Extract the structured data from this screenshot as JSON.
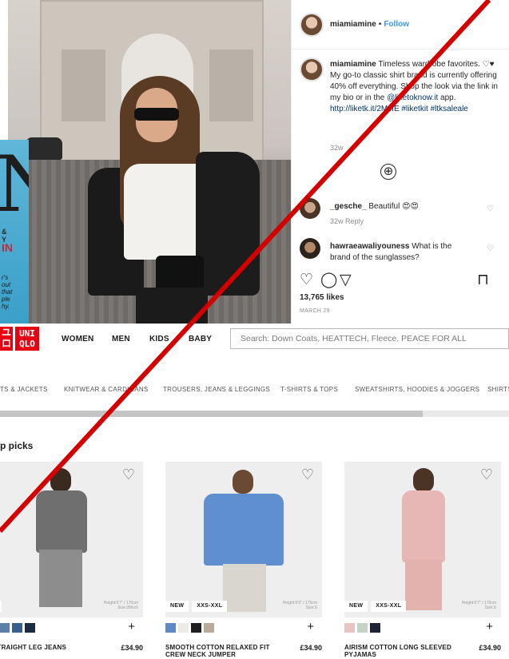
{
  "instagram": {
    "username": "miamiamine",
    "follow_label": "Follow",
    "separator": "•",
    "caption_user": "miamiamine",
    "caption_part1": " Timeless wardrobe favorites. ♡♥ My go-to classic shirt brand is currently offering 40% off everything. Shop the look via the link in my bio or in the ",
    "caption_mention": "@liketoknow.it",
    "caption_part2": " app. ",
    "caption_url": "http://liketk.it/2McfE",
    "caption_hashtags": " #liketkit #ltksaleale",
    "caption_age": "32w",
    "load_more": "⊕",
    "comments": [
      {
        "user": "_gesche_",
        "text": " Beautiful 😍😍",
        "meta": "32w   Reply"
      },
      {
        "user": "hawraeawaliyouness",
        "text": " What is the brand of the sunglasses?",
        "meta": ""
      }
    ],
    "likes": "13,765 likes",
    "date": "MARCH 29",
    "icons": [
      "heart-icon",
      "comment-icon",
      "share-icon",
      "bookmark-icon"
    ]
  },
  "magazine": {
    "letter": "N",
    "tagline": "&\nY",
    "headline": "IN",
    "blurb": "r's\nout\nthat\nple\nhy."
  },
  "uniqlo": {
    "logo_left": [
      "ユ",
      "ロ"
    ],
    "logo_right": [
      "UNI",
      "QLO"
    ],
    "nav": [
      "WOMEN",
      "MEN",
      "KIDS",
      "BABY"
    ],
    "search_placeholder": "Search: Down Coats, HEATTECH, Fleece, PEACE FOR ALL",
    "categories": [
      "TS & JACKETS",
      "KNITWEAR & CARDIGANS",
      "TROUSERS, JEANS & LEGGINGS",
      "T-SHIRTS & TOPS",
      "SWEATSHIRTS, HOODIES & JOGGERS",
      "SHIRTS"
    ],
    "scroll_fraction": 0.83,
    "section_title": "p picks",
    "products": [
      {
        "badges": [
          "W"
        ],
        "model_note": "Height:5'7\" / 170cm\nSize:28inch",
        "swatch_colors": [
          "#8fb4d4",
          "#5a7fa8",
          "#3b5f8c",
          "#1c2a44"
        ],
        "name": "E STRAIGHT LEG JEANS",
        "price": "£34.90",
        "photo_colors": {
          "body": "#6f6f6f",
          "legs": "#8d8d8d",
          "head": "#3a2a20"
        }
      },
      {
        "badges": [
          "NEW",
          "XXS-XXL"
        ],
        "model_note": "Height:5'9\" / 175cm\nSize:S",
        "swatch_colors": [
          "#5e88c6",
          "#ecebe6",
          "#1f1f1f",
          "#b9ab98"
        ],
        "name": "SMOOTH COTTON RELAXED FIT CREW NECK JUMPER",
        "price": "£34.90",
        "photo_colors": {
          "body": "#5f8fcf",
          "legs": "#d9d5cf",
          "head": "#6a4a33"
        }
      },
      {
        "badges": [
          "NEW",
          "XXS-XXL"
        ],
        "model_note": "Height:5'7\" / 170cm\nSize:S",
        "swatch_colors": [
          "#e8c4c3",
          "#c4d2c8",
          "#1e2433"
        ],
        "name": "AIRISM COTTON LONG SLEEVED PYJAMAS",
        "price": "£34.90",
        "photo_colors": {
          "body": "#e6b7b4",
          "legs": "#e3b1ae",
          "head": "#4b3325"
        }
      }
    ]
  },
  "colors": {
    "uniqlo_red": "#e60012",
    "ig_link": "#3897f0",
    "slash": "#d40000"
  }
}
